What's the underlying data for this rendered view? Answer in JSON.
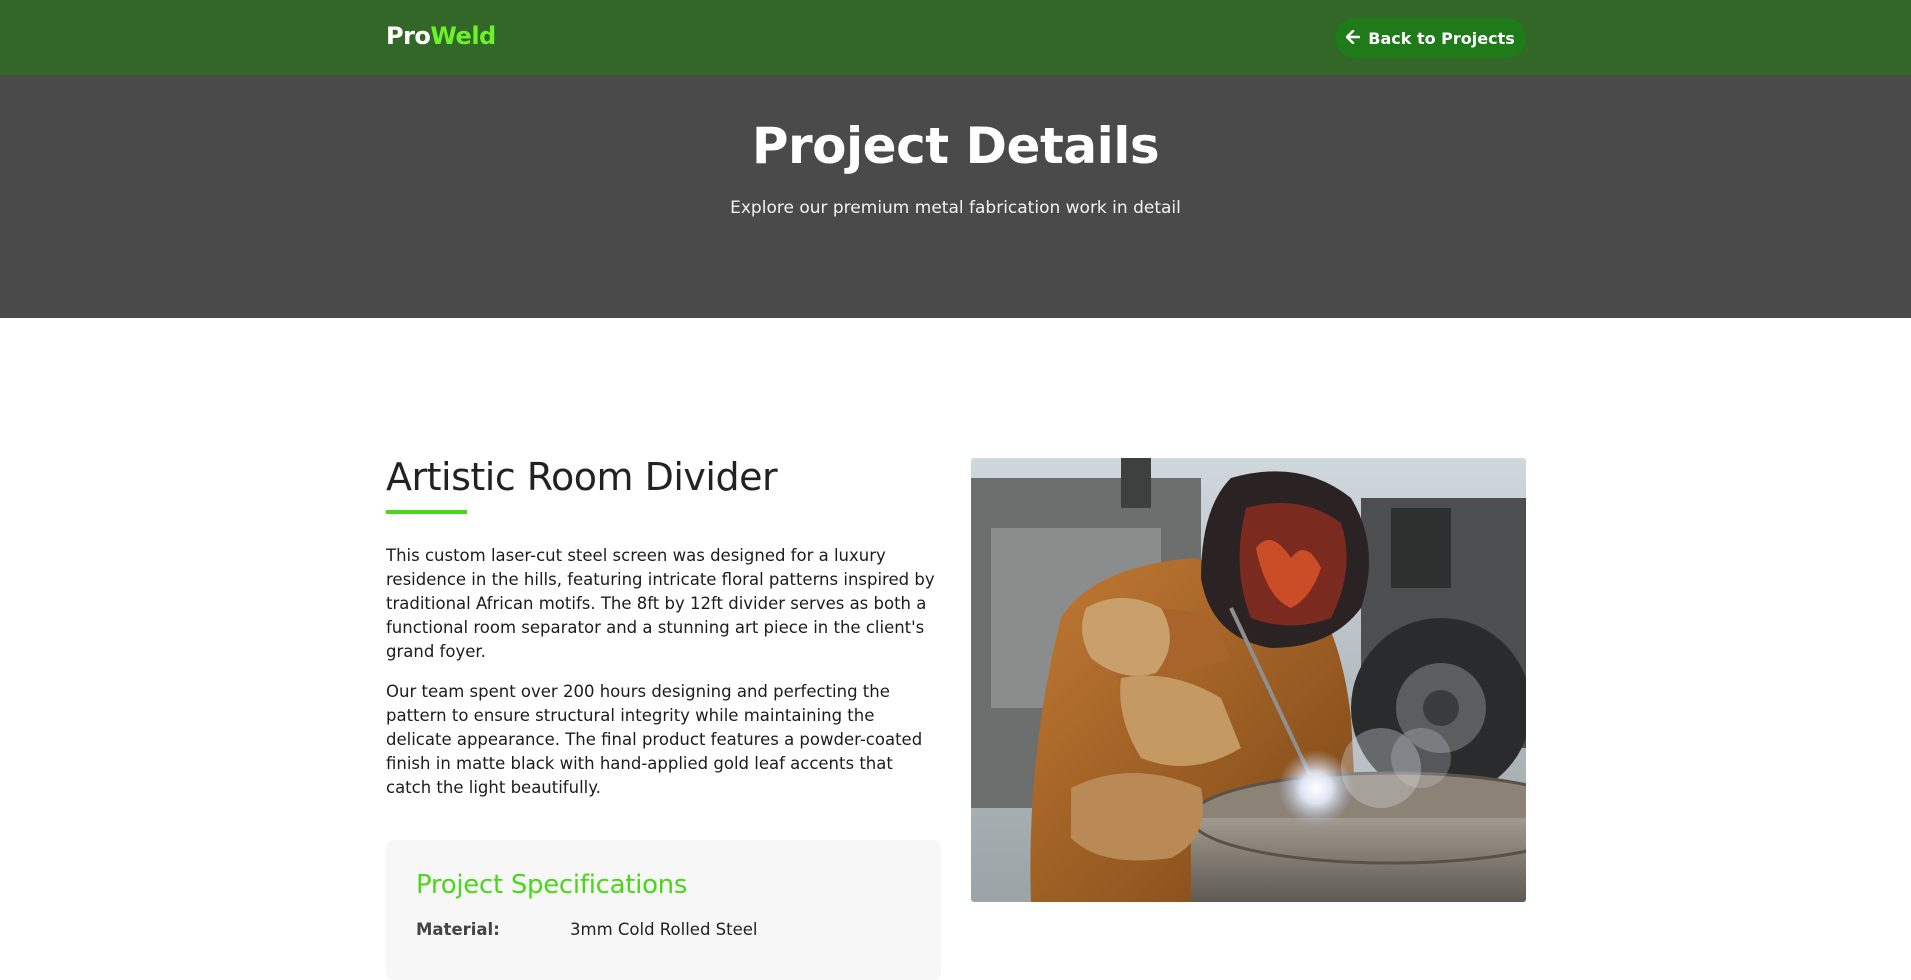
{
  "header": {
    "logo_part1": "Pro",
    "logo_part2": "Weld",
    "back_button_label": "Back to Projects",
    "back_icon": "arrow-left-icon"
  },
  "hero": {
    "title": "Project Details",
    "subtitle": "Explore our premium metal fabrication work in detail"
  },
  "project": {
    "title": "Artistic Room Divider",
    "description": [
      "This custom laser-cut steel screen was designed for a luxury residence in the hills, featuring intricate floral patterns inspired by traditional African motifs. The 8ft by 12ft divider serves as both a functional room separator and a stunning art piece in the client's grand foyer.",
      "Our team spent over 200 hours designing and perfecting the pattern to ensure structural integrity while maintaining the delicate appearance. The final product features a powder-coated finish in matte black with hand-applied gold leaf accents that catch the light beautifully."
    ],
    "specs": {
      "heading": "Project Specifications",
      "rows": [
        {
          "label": "Material:",
          "value": "3mm Cold Rolled Steel"
        }
      ]
    },
    "image_subject": "welder-at-work-photo"
  },
  "colors": {
    "header_bg": "#336728",
    "accent_green": "#6cf22b",
    "button_bg": "#1f7a1a",
    "hero_bg": "#4a4a4a",
    "specs_heading": "#4ad61a",
    "specs_bg": "#f7f7f8"
  }
}
